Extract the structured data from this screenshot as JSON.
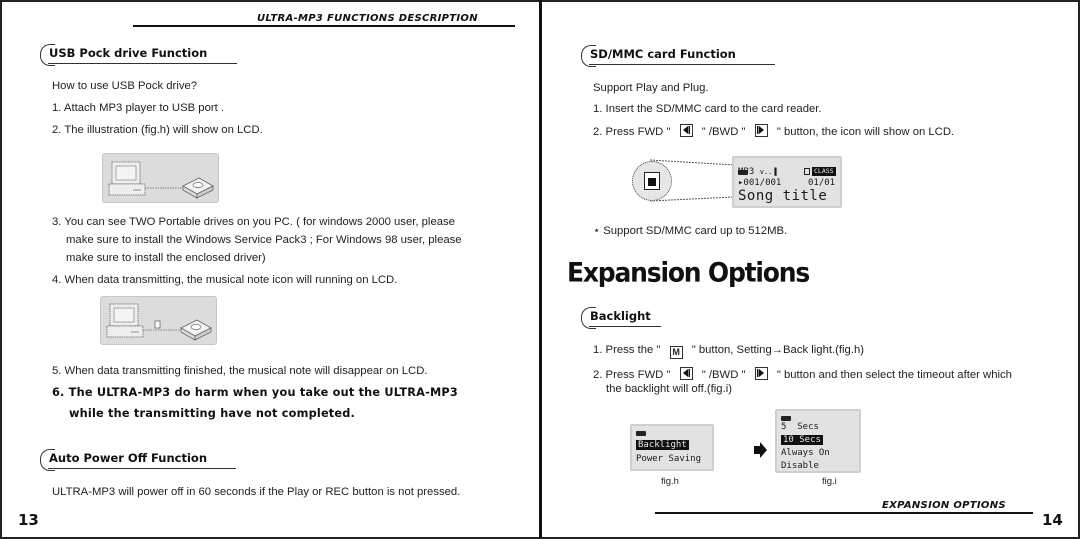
{
  "left_page": {
    "running_header": "ULTRA-MP3 FUNCTIONS DESCRIPTION",
    "page_number": "13",
    "usb_section": {
      "heading": "USB Pock drive Function",
      "intro": "How to use USB Pock drive?",
      "step1": "1. Attach MP3 player to USB port .",
      "step2": "2. The illustration (fig.h)  will show on LCD.",
      "step3_line1": "3. You can see TWO Portable drives on you PC. ( for windows 2000 user, please",
      "step3_line2": "make sure to install the Windows Service Pack3 ; For Windows 98 user, please",
      "step3_line3": "make sure to install the enclosed driver)",
      "step4": "4. When data transmitting, the musical note icon  will running on LCD.",
      "step5": "5. When data transmitting finished, the musical note will disappear on LCD.",
      "warning_line1": "6. The ULTRA-MP3 do harm when you take out the ULTRA-MP3",
      "warning_line2": "while the transmitting have not completed.",
      "illustration1": "pc-connected-to-player-illustration",
      "illustration2": "pc-transmitting-to-player-illustration"
    },
    "auto_power_section": {
      "heading": "Auto Power Off Function",
      "text": "ULTRA-MP3 will power off in 60 seconds if the Play or REC button is not pressed."
    }
  },
  "right_page": {
    "running_footer": "EXPANSION OPTIONS",
    "page_number": "14",
    "sd_section": {
      "heading": "SD/MMC card Function",
      "intro": "Support Play and Plug.",
      "step1": "1. Insert the SD/MMC card to the card reader.",
      "step2_a": "2. Press FWD \"",
      "step2_b": "\" /BWD \"",
      "step2_c": "\" button, the icon will show on LCD.",
      "note": "⋆ Support SD/MMC card up to 512MB.",
      "lcd": {
        "mode": "MP3",
        "volume": "v..▐",
        "eq_badge": "CLASS",
        "track": "▸001/001",
        "folder": "01/01",
        "title": "Song title"
      }
    },
    "expansion_title": "Expansion Options",
    "backlight_section": {
      "heading": "Backlight",
      "step1_a": "1. Press the \"",
      "step1_key": "M",
      "step1_b": "\" button, Setting→Back light.(fig.h)",
      "step2_a": "2. Press FWD \"",
      "step2_b": "\" /BWD \"",
      "step2_c": "\" button and then select the timeout after which",
      "step2_line2": "the backlight will off.(fig.i)",
      "fig_h": {
        "items": [
          "Backlight",
          "Power Saving"
        ],
        "selected": "Backlight",
        "caption": "fig.h"
      },
      "fig_i": {
        "items": [
          "5  Secs",
          "10 Secs",
          "Always On",
          "Disable"
        ],
        "selected": "10 Secs",
        "caption": "fig.i"
      }
    }
  }
}
